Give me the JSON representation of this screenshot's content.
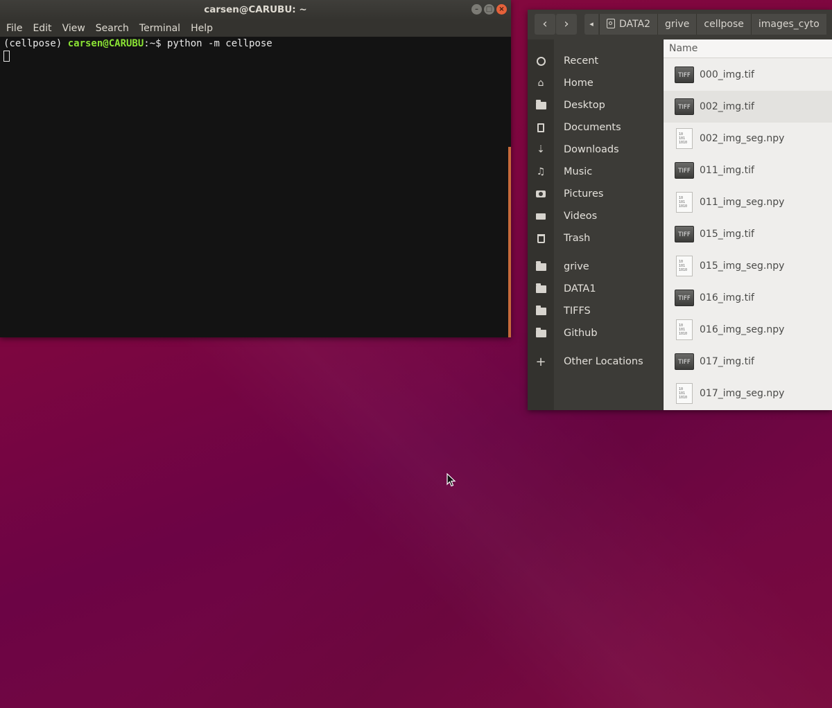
{
  "terminal": {
    "title": "carsen@CARUBU: ~",
    "menu": [
      "File",
      "Edit",
      "View",
      "Search",
      "Terminal",
      "Help"
    ],
    "prompt_prefix": "(cellpose) ",
    "prompt_user": "carsen@CARUBU",
    "prompt_path": ":~$ ",
    "command": "python -m cellpose",
    "window_buttons": [
      "minimize-icon",
      "maximize-icon",
      "close-icon"
    ]
  },
  "files": {
    "breadcrumbs": [
      "DATA2",
      "grive",
      "cellpose",
      "images_cyto"
    ],
    "column_name": "Name",
    "sidebar": [
      {
        "label": "Recent",
        "icon": "clock-icon"
      },
      {
        "label": "Home",
        "icon": "home-icon"
      },
      {
        "label": "Desktop",
        "icon": "folder-icon"
      },
      {
        "label": "Documents",
        "icon": "document-icon"
      },
      {
        "label": "Downloads",
        "icon": "download-icon"
      },
      {
        "label": "Music",
        "icon": "music-icon"
      },
      {
        "label": "Pictures",
        "icon": "camera-icon"
      },
      {
        "label": "Videos",
        "icon": "video-icon"
      },
      {
        "label": "Trash",
        "icon": "trash-icon"
      },
      {
        "label": "grive",
        "icon": "folder-icon"
      },
      {
        "label": "DATA1",
        "icon": "folder-icon"
      },
      {
        "label": "TIFFS",
        "icon": "folder-icon"
      },
      {
        "label": "Github",
        "icon": "folder-icon"
      },
      {
        "label": "Other Locations",
        "icon": "plus-icon"
      }
    ],
    "tiff_label": "TIFF",
    "items": [
      {
        "name": "000_img.tif",
        "type": "tiff"
      },
      {
        "name": "002_img.tif",
        "type": "tiff",
        "selected": true
      },
      {
        "name": "002_img_seg.npy",
        "type": "npy"
      },
      {
        "name": "011_img.tif",
        "type": "tiff"
      },
      {
        "name": "011_img_seg.npy",
        "type": "npy"
      },
      {
        "name": "015_img.tif",
        "type": "tiff"
      },
      {
        "name": "015_img_seg.npy",
        "type": "npy"
      },
      {
        "name": "016_img.tif",
        "type": "tiff"
      },
      {
        "name": "016_img_seg.npy",
        "type": "npy"
      },
      {
        "name": "017_img.tif",
        "type": "tiff"
      },
      {
        "name": "017_img_seg.npy",
        "type": "npy"
      }
    ]
  },
  "colors": {
    "desktop": "#7d0640",
    "prompt_user": "#8ae234",
    "terminal_bg": "#131313",
    "scrollbar": "#c76a3a",
    "close_button": "#e5613a"
  }
}
